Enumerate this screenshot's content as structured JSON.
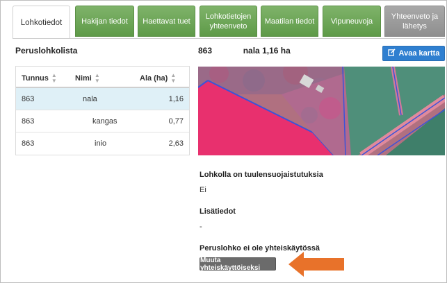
{
  "tabs": [
    {
      "label": "Lohkotiedot",
      "state": "active"
    },
    {
      "label": "Hakijan tiedot",
      "state": "green"
    },
    {
      "label": "Haettavat tuet",
      "state": "green"
    },
    {
      "label": "Lohkotietojen yhteenveto",
      "state": "green"
    },
    {
      "label": "Maatilan tiedot",
      "state": "green"
    },
    {
      "label": "Vipuneuvoja",
      "state": "green"
    },
    {
      "label": "Yhteenveto ja lähetys",
      "state": "grey"
    }
  ],
  "list": {
    "title": "Peruslohkolista",
    "columns": [
      "Tunnus",
      "Nimi",
      "Ala (ha)"
    ],
    "rows": [
      {
        "tunnus": "863",
        "nimi": "nala",
        "ala": "1,16",
        "selected": true
      },
      {
        "tunnus": "863",
        "nimi": "kangas",
        "ala": "0,77",
        "selected": false
      },
      {
        "tunnus": "863",
        "nimi": "inio",
        "ala": "2,63",
        "selected": false
      }
    ]
  },
  "detail": {
    "title_id": "863",
    "title_name": "nala 1,16 ha",
    "map_button": "Avaa kartta",
    "wind_label": "Lohkolla on tuulensuojaistutuksia",
    "wind_value": "Ei",
    "extra_label": "Lisätiedot",
    "extra_value": "-",
    "shared_label": "Peruslohko ei ole yhteiskäytössä",
    "shared_button": "Muuta yhteiskäyttöiseksi"
  },
  "colors": {
    "tab_green": "#6aa654",
    "tab_grey": "#9a9a9a",
    "map_button": "#2f7fd0",
    "selected_row": "#dff0f7",
    "arrow": "#e8722a"
  },
  "icons": {
    "sort": "sort-icon",
    "edit": "edit-icon",
    "arrow": "arrow-left-icon"
  }
}
